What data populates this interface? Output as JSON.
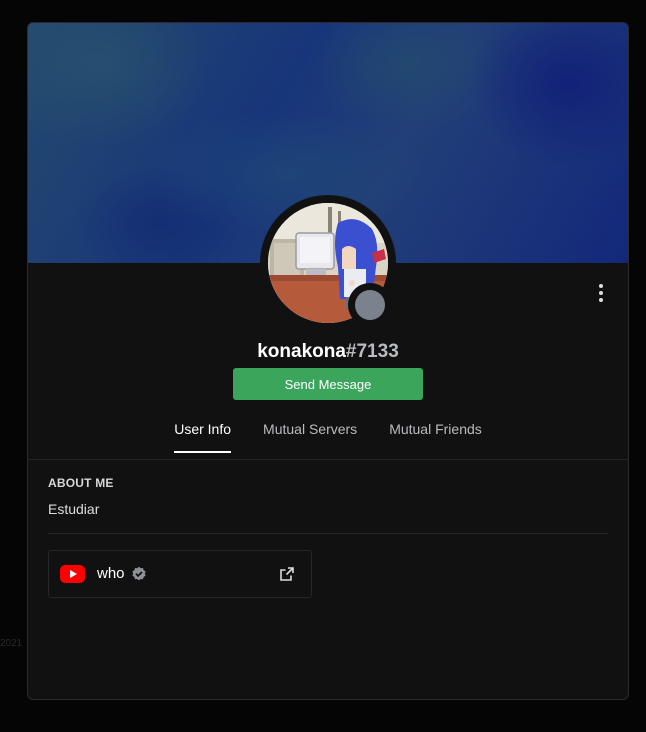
{
  "background": {
    "year_fragment": "2021"
  },
  "profile": {
    "username": "konakona",
    "discriminator": "#7133",
    "status": "offline",
    "status_color": "#747f8d",
    "avatar_icon": "profile-avatar-image"
  },
  "actions": {
    "send_message_label": "Send Message",
    "more_icon": "more-vertical-icon"
  },
  "tabs": [
    {
      "label": "User Info",
      "active": true
    },
    {
      "label": "Mutual Servers",
      "active": false
    },
    {
      "label": "Mutual Friends",
      "active": false
    }
  ],
  "about": {
    "heading": "ABOUT ME",
    "text": "Estudiar"
  },
  "connections": [
    {
      "service": "youtube",
      "service_icon": "youtube-icon",
      "name": "who",
      "verified": true,
      "link_icon": "external-link-icon"
    }
  ],
  "colors": {
    "accent_button": "#3ba55c",
    "modal_bg": "#111111",
    "youtube_red": "#ff0000"
  }
}
